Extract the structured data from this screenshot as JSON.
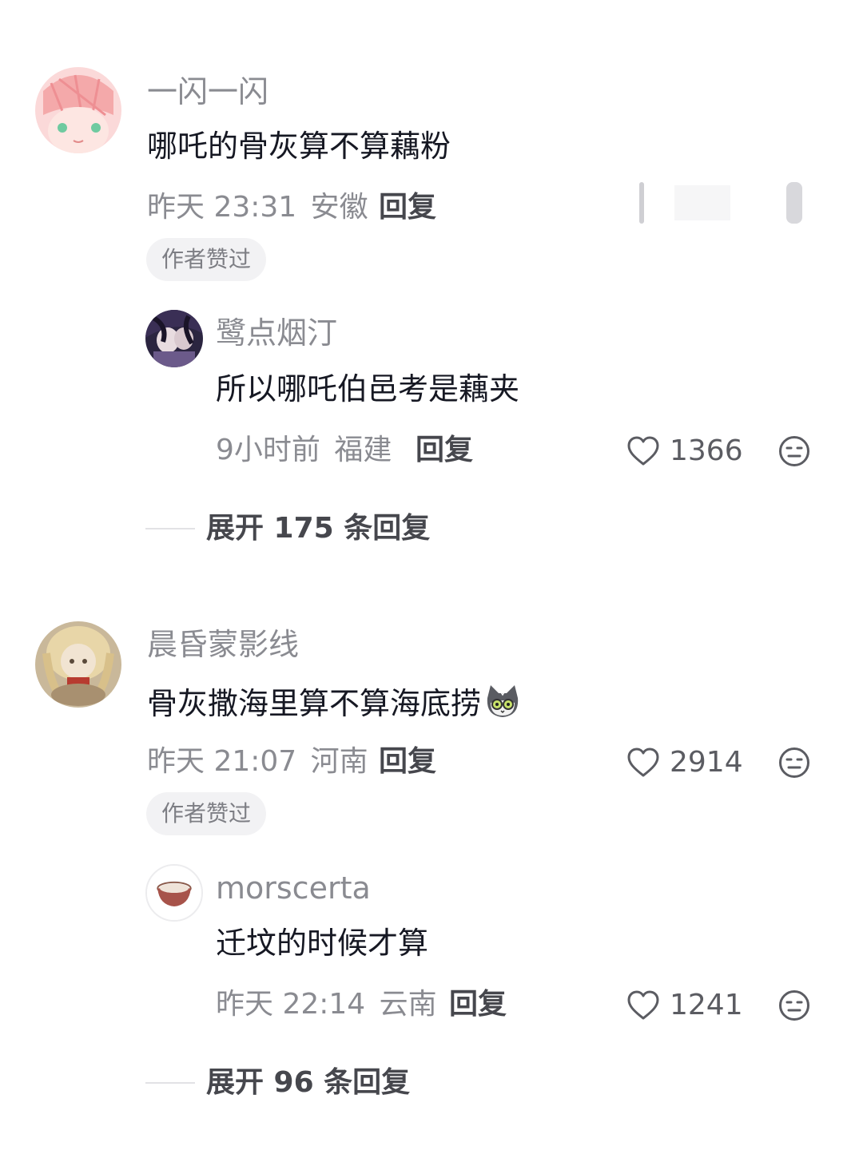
{
  "comments": [
    {
      "username": "一闪一闪",
      "content": "哪吒的骨灰算不算藕粉",
      "time": "昨天 23:31",
      "location": "安徽",
      "reply_label": "回复",
      "badge": "作者赞过",
      "avatar": "pink-anime-avatar",
      "replies": [
        {
          "username": "鹭点烟汀",
          "content": "所以哪吒伯邑考是藕夹",
          "time": "9小时前",
          "location": "福建",
          "reply_label": "回复",
          "likes": "1366",
          "avatar": "dark-anime-avatar"
        }
      ],
      "expand_label": "展开 175 条回复"
    },
    {
      "username": "晨昏蒙影线",
      "content": "骨灰撒海里算不算海底捞",
      "emoji": "cat-emoji",
      "time": "昨天 21:07",
      "location": "河南",
      "reply_label": "回复",
      "likes": "2914",
      "badge": "作者赞过",
      "avatar": "doll-photo-avatar",
      "replies": [
        {
          "username": "morscerta",
          "content": "迁坟的时候才算",
          "time": "昨天 22:14",
          "location": "云南",
          "reply_label": "回复",
          "likes": "1241",
          "avatar": "bowl-avatar"
        }
      ],
      "expand_label": "展开 96 条回复"
    }
  ],
  "icons": {
    "like": "heart-outline-icon",
    "dislike": "meh-face-icon"
  },
  "colors": {
    "username": "#8a8b91",
    "content": "#161823",
    "badge_bg": "#f2f2f4"
  }
}
